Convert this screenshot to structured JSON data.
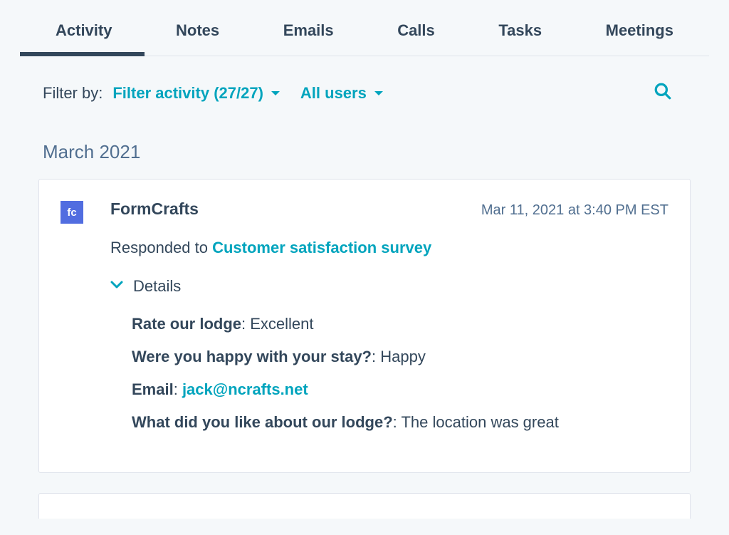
{
  "tabs": [
    {
      "label": "Activity",
      "active": true
    },
    {
      "label": "Notes",
      "active": false
    },
    {
      "label": "Emails",
      "active": false
    },
    {
      "label": "Calls",
      "active": false
    },
    {
      "label": "Tasks",
      "active": false
    },
    {
      "label": "Meetings",
      "active": false
    }
  ],
  "filter": {
    "label": "Filter by:",
    "activity_label": "Filter activity (27/27)",
    "users_label": "All users"
  },
  "month_heading": "March 2021",
  "timeline": {
    "source_badge": "fc",
    "source_name": "FormCrafts",
    "timestamp": "Mar 11, 2021 at 3:40 PM EST",
    "responded_prefix": "Responded to ",
    "survey_link": "Customer satisfaction survey",
    "details_label": "Details",
    "details": [
      {
        "q": "Rate our lodge",
        "a": "Excellent",
        "is_link": false
      },
      {
        "q": "Were you happy with your stay?",
        "a": "Happy",
        "is_link": false
      },
      {
        "q": "Email",
        "a": "jack@ncrafts.net",
        "is_link": true
      },
      {
        "q": "What did you like about our lodge?",
        "a": "The location was great",
        "is_link": false
      }
    ]
  }
}
